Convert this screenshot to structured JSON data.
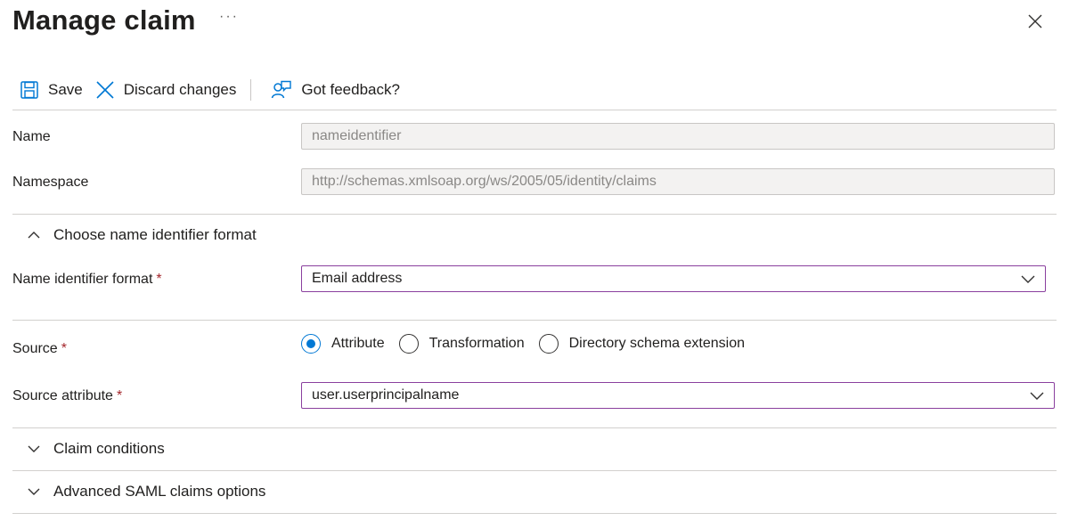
{
  "header": {
    "title": "Manage claim",
    "more_label": "···"
  },
  "toolbar": {
    "save_label": "Save",
    "discard_label": "Discard changes",
    "feedback_label": "Got feedback?"
  },
  "form": {
    "name": {
      "label": "Name",
      "value": "nameidentifier"
    },
    "namespace": {
      "label": "Namespace",
      "value": "http://schemas.xmlsoap.org/ws/2005/05/identity/claims"
    },
    "name_id_section": {
      "label": "Choose name identifier format",
      "expanded": true
    },
    "name_id_format": {
      "label": "Name identifier format",
      "required_mark": "*",
      "value": "Email address"
    },
    "source": {
      "label": "Source",
      "required_mark": "*",
      "options": [
        "Attribute",
        "Transformation",
        "Directory schema extension"
      ],
      "selected": "Attribute"
    },
    "source_attribute": {
      "label": "Source attribute",
      "required_mark": "*",
      "value": "user.userprincipalname"
    },
    "claim_conditions": {
      "label": "Claim conditions",
      "expanded": false
    },
    "advanced_saml": {
      "label": "Advanced SAML claims options",
      "expanded": false
    }
  },
  "colors": {
    "accent": "#0078d4",
    "focus_border": "#8a3f9e",
    "required": "#a4262c"
  }
}
